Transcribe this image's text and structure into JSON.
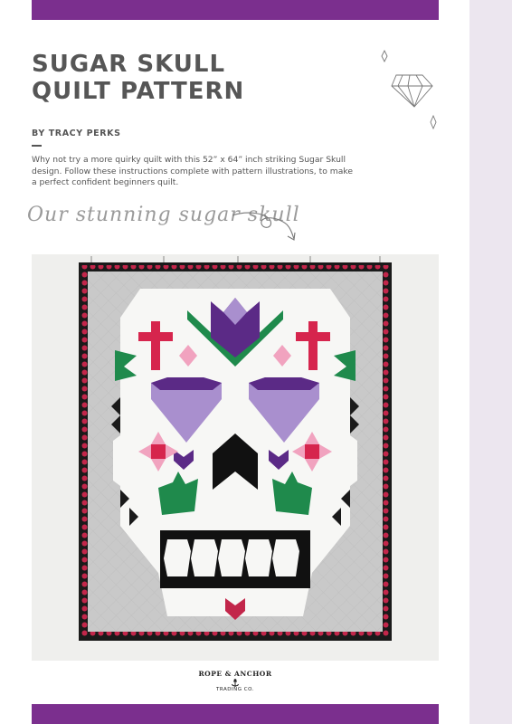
{
  "header": {
    "title_line1": "SUGAR SKULL",
    "title_line2": "QUILT PATTERN",
    "byline": "BY TRACY PERKS",
    "intro": "Why not try a more quirky quilt with this 52” x 64” inch striking Sugar Skull design. Follow these instructions complete with pattern illustrations, to make a perfect confident beginners quilt.",
    "script_caption": "Our stunning sugar skull"
  },
  "logo": {
    "line1": "ROPE & ANCHOR",
    "line2": "TRADING CO.",
    "icon": "anchor-icon"
  },
  "colors": {
    "accent_purple": "#7b2f8e",
    "side_strip": "#ece6ef",
    "quilt_border": "#1a1a1a",
    "pompom_red": "#c2264a",
    "skull_white": "#f7f7f5",
    "quilt_grey": "#c9c9c9",
    "heart_lilac": "#a98fce",
    "tulip_purple": "#5b2a86",
    "leaf_green": "#1f8a4c",
    "cross_red": "#d6254d",
    "diamond_pink": "#f1a3bf"
  }
}
